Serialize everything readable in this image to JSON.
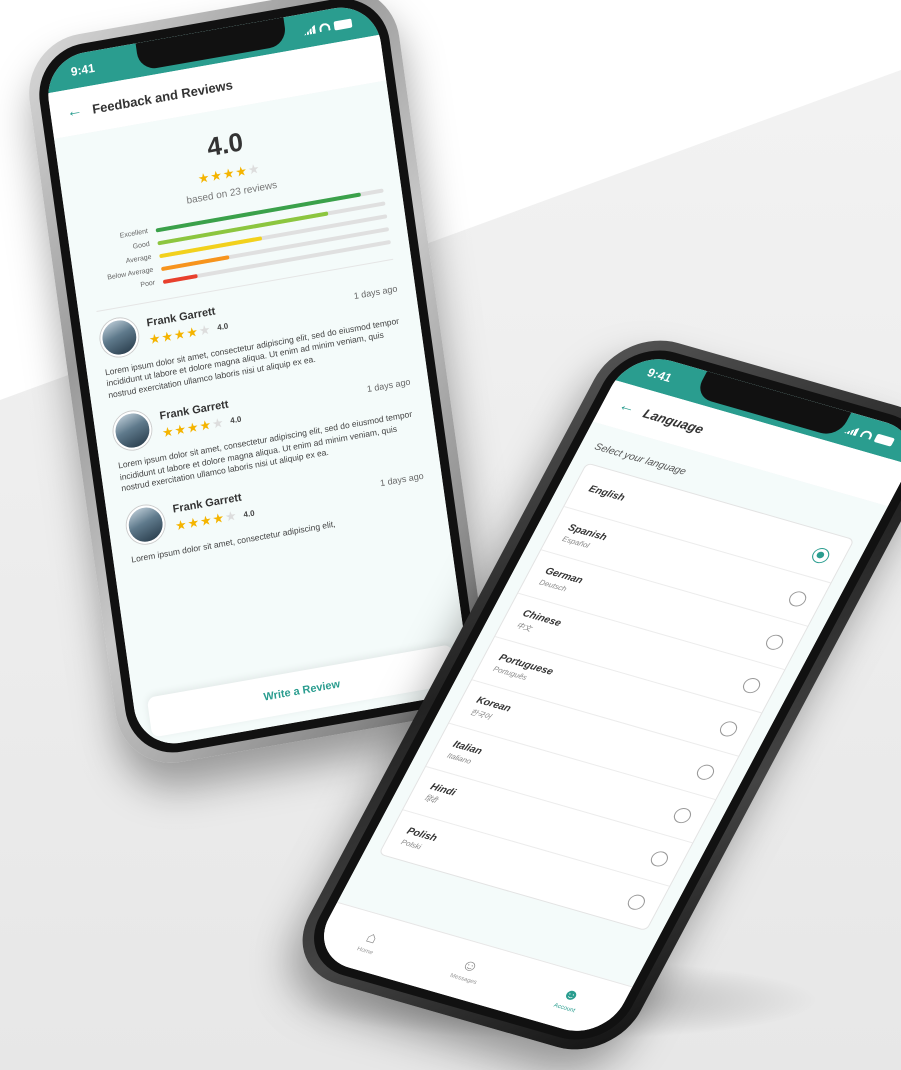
{
  "review_screen": {
    "status": {
      "time": "9:41"
    },
    "header": {
      "back_icon": "arrow-left-icon",
      "title": "Feedback and Reviews"
    },
    "summary": {
      "rating": "4.0",
      "stars": 4,
      "based_on": "based on 23 reviews"
    },
    "distribution": [
      {
        "label": "Excellent",
        "fill": 0.9,
        "color": "#3aa14a"
      },
      {
        "label": "Good",
        "fill": 0.75,
        "color": "#8cc63f"
      },
      {
        "label": "Average",
        "fill": 0.45,
        "color": "#f2d11c"
      },
      {
        "label": "Below Average",
        "fill": 0.3,
        "color": "#f7941d"
      },
      {
        "label": "Poor",
        "fill": 0.15,
        "color": "#e8402d"
      }
    ],
    "reviews": [
      {
        "name": "Frank Garrett",
        "stars": 4,
        "score": "4.0",
        "time": "1 days ago",
        "text": "Lorem ipsum dolor sit amet, consectetur adipiscing elit, sed do eiusmod tempor incididunt ut labore et dolore magna aliqua. Ut enim ad minim veniam, quis nostrud exercitation ullamco laboris nisi ut aliquip ex ea."
      },
      {
        "name": "Frank Garrett",
        "stars": 4,
        "score": "4.0",
        "time": "1 days ago",
        "text": "Lorem ipsum dolor sit amet, consectetur adipiscing elit, sed do eiusmod tempor incididunt ut labore et dolore magna aliqua. Ut enim ad minim veniam, quis nostrud exercitation ullamco laboris nisi ut aliquip ex ea."
      },
      {
        "name": "Frank Garrett",
        "stars": 4,
        "score": "4.0",
        "time": "1 days ago",
        "text": "Lorem ipsum dolor sit amet, consectetur adipiscing elit,"
      }
    ],
    "write_review_label": "Write a Review"
  },
  "language_screen": {
    "status": {
      "time": "9:41"
    },
    "header": {
      "back_icon": "arrow-left-icon",
      "title": "Language"
    },
    "select_label": "Select your language",
    "languages": [
      {
        "name": "English",
        "native": "",
        "selected": true
      },
      {
        "name": "Spanish",
        "native": "Español",
        "selected": false
      },
      {
        "name": "German",
        "native": "Deutsch",
        "selected": false
      },
      {
        "name": "Chinese",
        "native": "中文",
        "selected": false
      },
      {
        "name": "Portuguese",
        "native": "Português",
        "selected": false
      },
      {
        "name": "Korean",
        "native": "한국어",
        "selected": false
      },
      {
        "name": "Italian",
        "native": "Italiano",
        "selected": false
      },
      {
        "name": "Hindi",
        "native": "हिंदी",
        "selected": false
      },
      {
        "name": "Polish",
        "native": "Polski",
        "selected": false
      }
    ],
    "bottom_nav": [
      {
        "label": "Home",
        "icon": "home-icon",
        "glyph": "⌂",
        "active": false
      },
      {
        "label": "Messages",
        "icon": "chat-icon",
        "glyph": "☺",
        "active": false
      },
      {
        "label": "Account",
        "icon": "account-icon",
        "glyph": "☻",
        "active": true
      }
    ]
  },
  "colors": {
    "accent": "#2a9d8f",
    "star": "#f4b400"
  }
}
